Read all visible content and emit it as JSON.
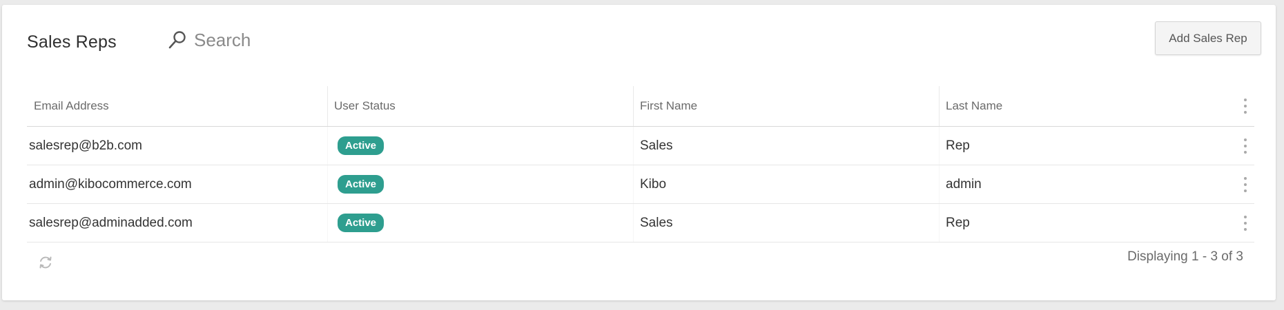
{
  "page": {
    "title": "Sales Reps"
  },
  "search": {
    "placeholder": "Search",
    "value": ""
  },
  "toolbar": {
    "add_label": "Add Sales Rep"
  },
  "table": {
    "columns": [
      {
        "key": "email",
        "label": "Email Address"
      },
      {
        "key": "status",
        "label": "User Status"
      },
      {
        "key": "first_name",
        "label": "First Name"
      },
      {
        "key": "last_name",
        "label": "Last Name"
      }
    ],
    "rows": [
      {
        "email": "salesrep@b2b.com",
        "status": "Active",
        "first_name": "Sales",
        "last_name": "Rep"
      },
      {
        "email": "admin@kibocommerce.com",
        "status": "Active",
        "first_name": "Kibo",
        "last_name": "admin"
      },
      {
        "email": "salesrep@adminadded.com",
        "status": "Active",
        "first_name": "Sales",
        "last_name": "Rep"
      }
    ]
  },
  "footer": {
    "paging_text": "Displaying 1 - 3 of 3"
  },
  "icons": {
    "search": "search-icon",
    "row_menu": "more-vertical-icon",
    "column_menu": "more-vertical-icon",
    "refresh": "refresh-icon"
  },
  "colors": {
    "status_active": "#2e9e8f",
    "page_background": "#ebebeb",
    "card_background": "#ffffff"
  }
}
